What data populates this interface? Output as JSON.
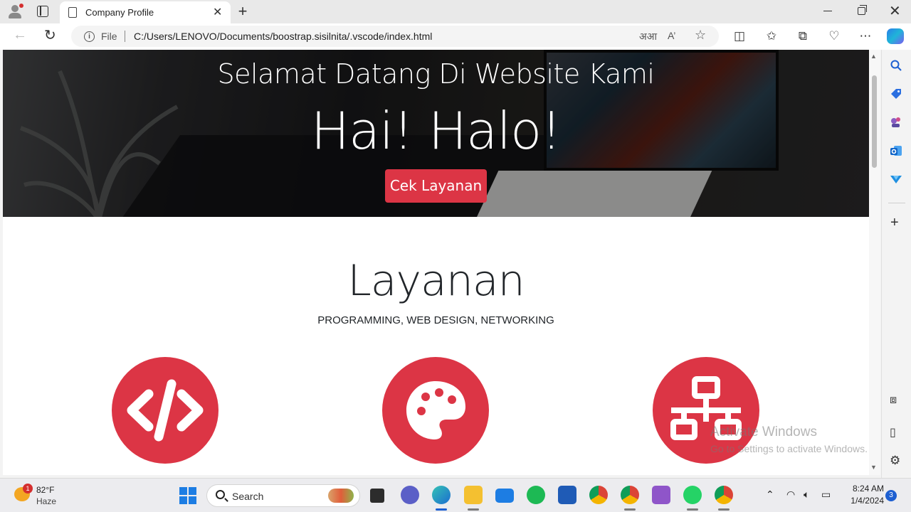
{
  "browser": {
    "tab_title": "Company Profile",
    "file_label": "File",
    "url": "C:/Users/LENOVO/Documents/boostrap.sisilnita/.vscode/index.html",
    "read_aloud_label": "A’",
    "translate_label": "अआ"
  },
  "hero": {
    "subtitle": "Selamat Datang Di Website Kami",
    "title": "Hai! Halo!",
    "button_label": "Cek Layanan"
  },
  "services": {
    "title": "Layanan",
    "subtitle": "PROGRAMMING, WEB DESIGN, NETWORKING",
    "items": [
      {
        "icon": "code-icon"
      },
      {
        "icon": "palette-icon"
      },
      {
        "icon": "network-icon"
      }
    ]
  },
  "watermark": {
    "line1": "Activate Windows",
    "line2": "Go to Settings to activate Windows."
  },
  "taskbar": {
    "weather_temp": "82°F",
    "weather_cond": "Haze",
    "weather_badge": "1",
    "search_label": "Search",
    "time": "8:24 AM",
    "date": "1/4/2024",
    "notification_count": "3"
  },
  "colors": {
    "accent_red": "#dc3545",
    "edge_blue": "#1d7de3"
  }
}
